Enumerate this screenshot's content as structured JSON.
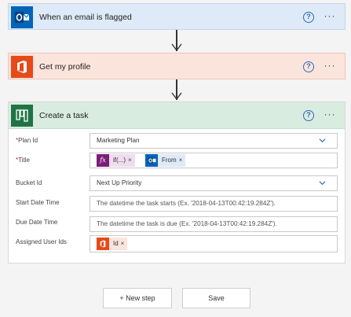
{
  "steps": [
    {
      "title": "When an email is flagged",
      "icon": "outlook-icon",
      "accent": "#0364b8"
    },
    {
      "title": "Get my profile",
      "icon": "office-icon",
      "accent": "#e64a19"
    },
    {
      "title": "Create a task",
      "icon": "planner-icon",
      "accent": "#217346"
    }
  ],
  "help_symbol": "?",
  "more_symbol": "···",
  "required_mark": "*",
  "form": {
    "plan_id": {
      "label": "Plan Id",
      "value": "Marketing Plan"
    },
    "title": {
      "label": "Title",
      "tokens": [
        {
          "text": "if(...)",
          "icon": "fx-icon",
          "color": "#7b1e7a",
          "bg": "#f0dcef"
        },
        {
          "text": "From",
          "icon": "outlook-icon",
          "color": "#0364b8",
          "bg": "#deeaf7"
        }
      ]
    },
    "bucket_id": {
      "label": "Bucket Id",
      "value": "Next Up Priority"
    },
    "start_date": {
      "label": "Start Date Time",
      "placeholder": "The datetime the task starts (Ex. '2018-04-13T00:42:19.284Z')."
    },
    "due_date": {
      "label": "Due Date Time",
      "placeholder": "The datetime the task is due (Ex. '2018-04-13T00:42:19.284Z')."
    },
    "assigned_user_ids": {
      "label": "Assigned User Ids",
      "tokens": [
        {
          "text": "Id",
          "icon": "office-icon",
          "color": "#e64a19",
          "bg": "#fbe4dc"
        }
      ]
    }
  },
  "token_remove_symbol": "×",
  "buttons": {
    "new_step": "+ New step",
    "save": "Save"
  }
}
